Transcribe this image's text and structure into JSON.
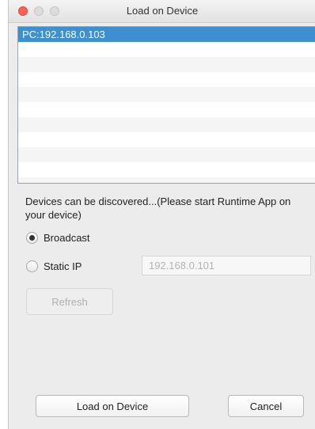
{
  "window": {
    "title": "Load on Device"
  },
  "device_list": {
    "items": [
      "PC:192.168.0.103"
    ],
    "selected_index": 0
  },
  "discovery": {
    "message": "Devices can be discovered...(Please start Runtime App on your device)"
  },
  "connection": {
    "broadcast_label": "Broadcast",
    "broadcast_selected": true,
    "static_ip_label": "Static IP",
    "static_ip_selected": false,
    "static_ip_value": "192.168.0.101"
  },
  "buttons": {
    "refresh_label": "Refresh",
    "load_label": "Load on Device",
    "cancel_label": "Cancel"
  },
  "colors": {
    "selection": "#3d8fd0",
    "close_button": "#fc605b"
  }
}
